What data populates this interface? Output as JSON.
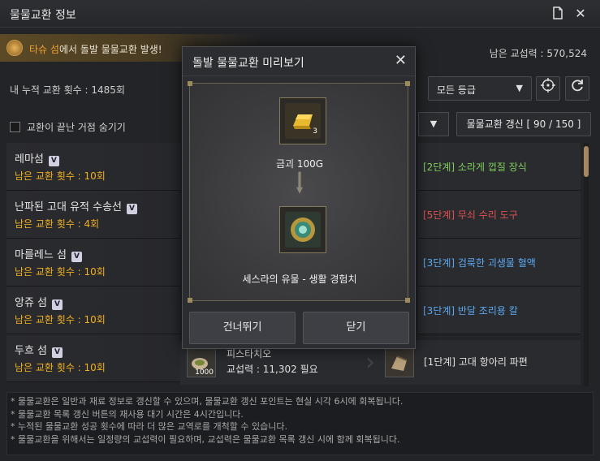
{
  "window": {
    "title": "물물교환 정보"
  },
  "notice": {
    "island": "타슈 섬",
    "text": "에서 돌발 물물교환 발생!"
  },
  "status": {
    "remaining_power": "남은 교섭력 : 570,524",
    "cumulative": "내 누적 교환 횟수 : 1485회"
  },
  "controls": {
    "hide_done_label": "교환이 끝난 거점 숨기기",
    "grade_select": "모든 등급",
    "refresh_label": "물물교환 갱신 [ 90 / 150 ]"
  },
  "islands": [
    {
      "name": "레마섬",
      "badge": "V",
      "count": "남은 교환 횟수 : 10회"
    },
    {
      "name": "난파된 고대 유적 수송선",
      "badge": "V",
      "count": "남은 교환 횟수 : 4회"
    },
    {
      "name": "마를레느 섬",
      "badge": "V",
      "count": "남은 교환 횟수 : 10회"
    },
    {
      "name": "앙쥬 섬",
      "badge": "V",
      "count": "남은 교환 횟수 : 10회"
    },
    {
      "name": "두흐 섬",
      "badge": "V",
      "count": "남은 교환 횟수 : 10회"
    }
  ],
  "trades": [
    {
      "text": "[2단계] 소라게 껍질 장식",
      "color": "#7fcf5a"
    },
    {
      "text": "[5단계] 무쇠 수리 도구",
      "color": "#e05050"
    },
    {
      "text": "[3단계] 검룩한 괴생물 혈액",
      "color": "#5aa8f0"
    },
    {
      "text": "[3단계] 반달 조리용 칼",
      "color": "#5aa8f0"
    }
  ],
  "row5": {
    "item_name": "피스타치오",
    "item_qty": "1000",
    "requirement": "교섭력 : 11,302 필요",
    "trade_text": "[1단계] 고대 항아리 파편"
  },
  "footer": [
    "* 물물교환은 일반과 재료 정보로 갱신할 수 있으며, 물물교환 갱신 포인트는 현실 시각 6시에 회복됩니다.",
    "* 물물교환 목록 갱신 버튼의 재사용 대기 시간은 4시간입니다.",
    "* 누적된 물물교환 성공 횟수에 따라 더 많은 교역로를 개척할 수 있습니다.",
    "* 물물교환을 위해서는 일정량의 교섭력이 필요하며, 교섭력은 물물교환 목록 갱신 시에 함께 회복됩니다."
  ],
  "modal": {
    "title": "돌발 물물교환 미리보기",
    "give_item": "금괴 100G",
    "give_qty": "3",
    "get_item": "세스라의 유물 - 생활 경험치",
    "skip_button": "건너뛰기",
    "close_button": "닫기"
  }
}
